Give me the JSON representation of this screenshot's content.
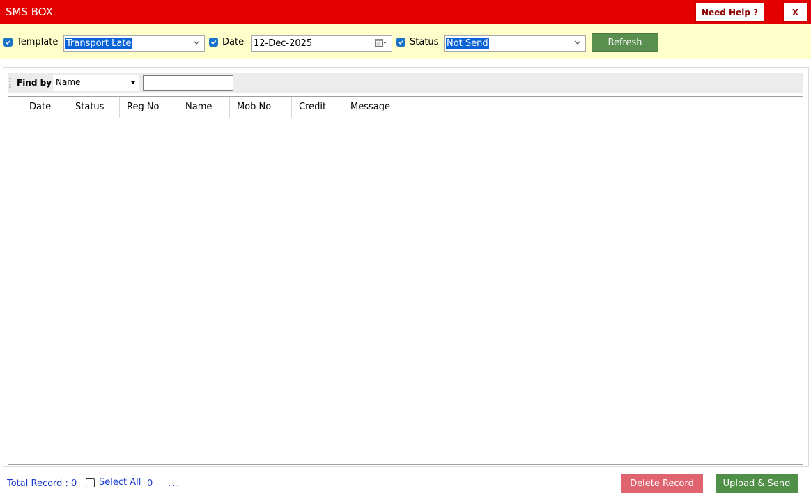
{
  "window": {
    "title": "SMS BOX",
    "help_label": "Need Help ?",
    "close_label": "X"
  },
  "filters": {
    "template": {
      "label": "Template",
      "checked": true,
      "value": "Transport Late"
    },
    "date": {
      "label": "Date",
      "checked": true,
      "value": "12-Dec-2025"
    },
    "status": {
      "label": "Status",
      "checked": true,
      "value": "Not Send"
    },
    "refresh_label": "Refresh"
  },
  "find": {
    "label": "Find by",
    "field": "Name",
    "query": ""
  },
  "grid": {
    "columns": [
      "Date",
      "Status",
      "Reg No",
      "Name",
      "Mob No",
      "Credit",
      "Message"
    ],
    "rows": []
  },
  "footer": {
    "total_record": "Total Record : 0",
    "select_all_label": "Select All",
    "select_all_checked": false,
    "selected_count": "0",
    "dots": "..."
  },
  "actions": {
    "delete_label": "Delete Record",
    "send_label": "Upload & Send"
  },
  "colors": {
    "titlebar": "#e30000",
    "filterbar": "#ffffcc",
    "refresh": "#5b8f4f",
    "delete": "#e06470",
    "send": "#4f8f48",
    "footer_text": "#1a3ccf"
  }
}
